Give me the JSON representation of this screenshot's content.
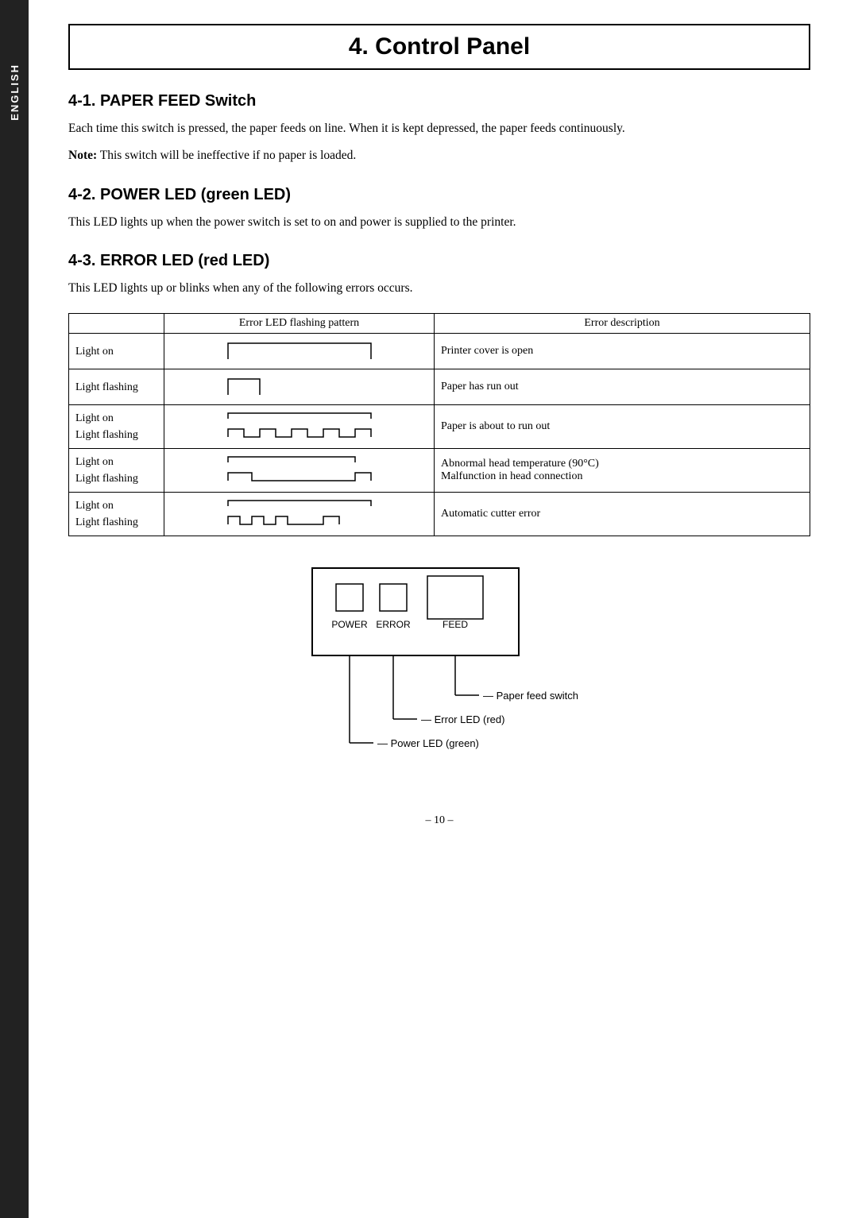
{
  "sidebar": {
    "label": "ENGLISH"
  },
  "page": {
    "title": "4. Control Panel",
    "page_number": "– 10 –"
  },
  "section1": {
    "heading": "4-1.  PAPER FEED Switch",
    "para1": "Each time this switch is pressed, the paper feeds on line. When it is kept depressed, the paper feeds continuously.",
    "note": "Note:",
    "note_text": "  This switch will be ineffective if no paper is loaded."
  },
  "section2": {
    "heading": "4-2.  POWER LED (green LED)",
    "para1": "This LED lights up when the power switch is set to on and power is supplied to the printer."
  },
  "section3": {
    "heading": "4-3.  ERROR LED (red LED)",
    "para1": "This LED lights up or blinks when any of the following errors occurs."
  },
  "table": {
    "col1_header": "",
    "col2_header": "Error LED flashing pattern",
    "col3_header": "Error description",
    "rows": [
      {
        "light_status": [
          "Light on",
          ""
        ],
        "description": "Printer cover is open"
      },
      {
        "light_status": [
          "Light flashing",
          ""
        ],
        "description": "Paper has run out"
      },
      {
        "light_status": [
          "Light on",
          "Light flashing"
        ],
        "description": "Paper is about to run out"
      },
      {
        "light_status": [
          "Light on",
          "Light flashing"
        ],
        "description": "Abnormal head temperature (90°C)\nMalfunction in head connection"
      },
      {
        "light_status": [
          "Light on",
          "Light flashing"
        ],
        "description": "Automatic cutter error"
      }
    ]
  },
  "diagram": {
    "power_label": "POWER",
    "error_label": "ERROR",
    "feed_label": "FEED",
    "arrow1": "Paper feed switch",
    "arrow2": "Error LED (red)",
    "arrow3": "Power LED (green)"
  }
}
